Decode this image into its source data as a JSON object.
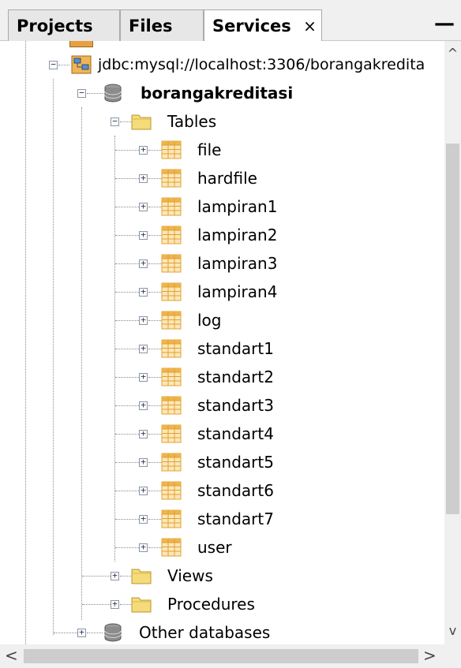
{
  "tabs": [
    {
      "label": "Projects",
      "active": false
    },
    {
      "label": "Files",
      "active": false
    },
    {
      "label": "Services",
      "active": true
    }
  ],
  "tab_close_glyph": "×",
  "minimize_glyph": "—",
  "tree": {
    "connection": {
      "label": "jdbc:mysql://localhost:3306/borangakredita",
      "icon": "db-connection-icon",
      "expanded": true
    },
    "database": {
      "label": "borangakreditasi",
      "icon": "database-icon",
      "expanded": true
    },
    "tables_folder": {
      "label": "Tables",
      "icon": "folder-icon",
      "expanded": true
    },
    "tables": [
      {
        "label": "file"
      },
      {
        "label": "hardfile"
      },
      {
        "label": "lampiran1"
      },
      {
        "label": "lampiran2"
      },
      {
        "label": "lampiran3"
      },
      {
        "label": "lampiran4"
      },
      {
        "label": "log"
      },
      {
        "label": "standart1"
      },
      {
        "label": "standart2"
      },
      {
        "label": "standart3"
      },
      {
        "label": "standart4"
      },
      {
        "label": "standart5"
      },
      {
        "label": "standart6"
      },
      {
        "label": "standart7"
      },
      {
        "label": "user"
      }
    ],
    "views_folder": {
      "label": "Views",
      "icon": "folder-icon",
      "expanded": false
    },
    "procedures_folder": {
      "label": "Procedures",
      "icon": "folder-icon",
      "expanded": false
    },
    "other_databases": {
      "label": "Other databases",
      "icon": "database-icon",
      "expanded": false
    }
  },
  "colors": {
    "folder": "#f5dc7a",
    "table_grid": "#e0a030",
    "database": "#8c8c8c",
    "connection": "#e8a040"
  },
  "scroll": {
    "up": "^",
    "down": "v",
    "left": "<",
    "right": ">"
  }
}
